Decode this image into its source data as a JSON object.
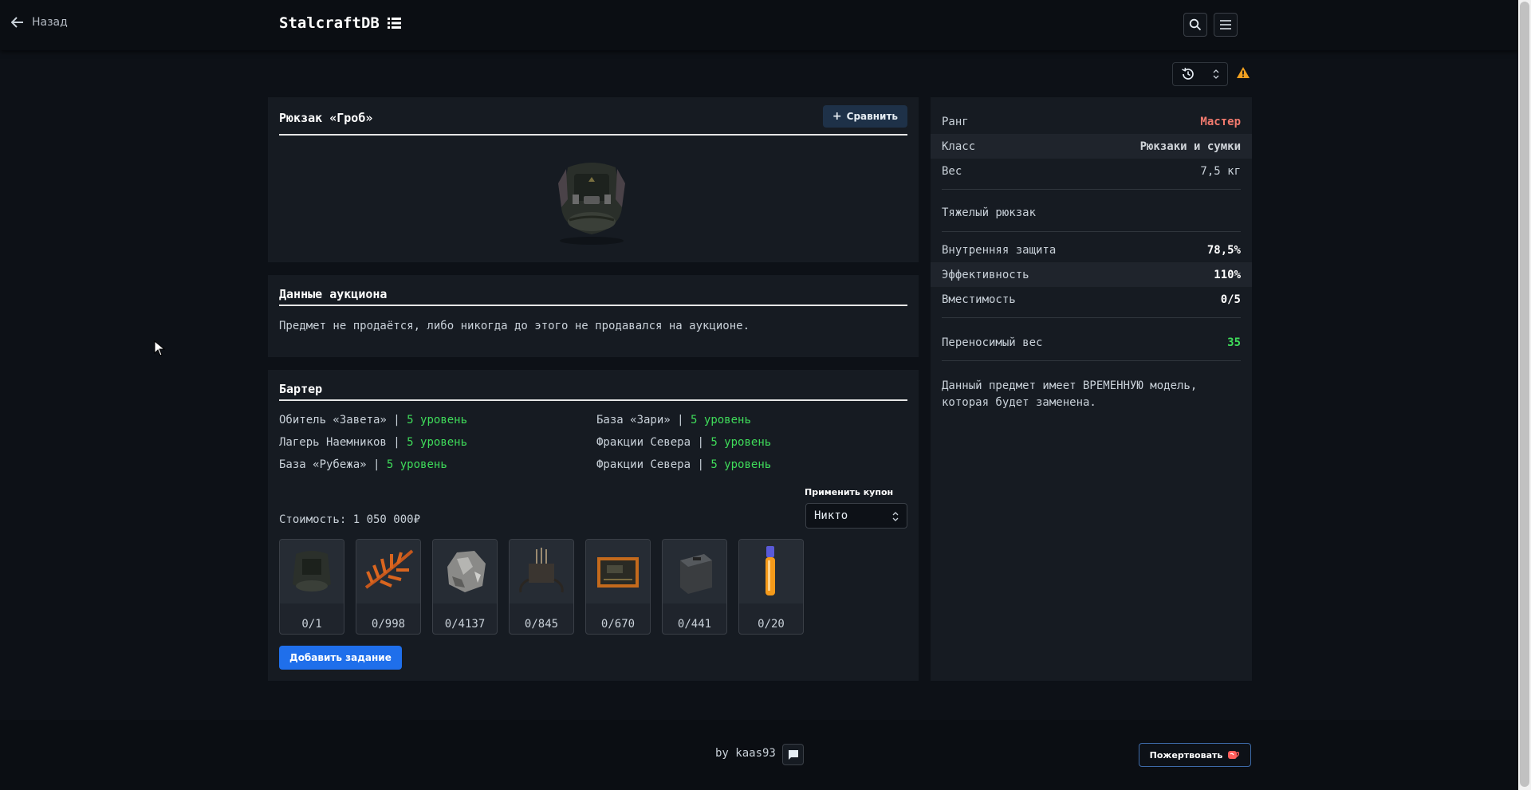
{
  "header": {
    "back_label": "Назад",
    "brand": "StalcraftDB"
  },
  "item": {
    "name": "Рюкзак «Гроб»",
    "compare_label": "Сравнить"
  },
  "auction": {
    "title": "Данные аукциона",
    "message": "Предмет не продаётся, либо никогда до этого не продавался на аукционе."
  },
  "barter": {
    "title": "Бартер",
    "separator": "|",
    "entries": [
      {
        "place": "Обитель «Завета»",
        "level": "5 уровень"
      },
      {
        "place": "База «Зари»",
        "level": "5 уровень"
      },
      {
        "place": "Лагерь Наемников",
        "level": "5 уровень"
      },
      {
        "place": "Фракции Севера",
        "level": "5 уровень"
      },
      {
        "place": "База «Рубежа»",
        "level": "5 уровень"
      },
      {
        "place": "Фракции Севера",
        "level": "5 уровень"
      }
    ],
    "coupon_label": "Применить купон",
    "coupon_value": "Никто",
    "cost": "Стоимость: 1 050 000₽",
    "ingredients": [
      {
        "count": "0/1",
        "icon": "backpack"
      },
      {
        "count": "0/998",
        "icon": "orange-fern"
      },
      {
        "count": "0/4137",
        "icon": "ore-chunk"
      },
      {
        "count": "0/845",
        "icon": "device-part"
      },
      {
        "count": "0/670",
        "icon": "circuit-board"
      },
      {
        "count": "0/441",
        "icon": "battery-case"
      },
      {
        "count": "0/20",
        "icon": "vial"
      }
    ],
    "add_task_label": "Добавить задание"
  },
  "stats": {
    "rank_label": "Ранг",
    "rank_value": "Мастер",
    "class_label": "Класс",
    "class_value": "Рюкзаки и сумки",
    "weight_label": "Вес",
    "weight_value": "7,5 кг",
    "type": "Тяжелый рюкзак",
    "protection_label": "Внутренняя защита",
    "protection_value": "78,5%",
    "efficiency_label": "Эффективность",
    "efficiency_value": "110%",
    "capacity_label": "Вместимость",
    "capacity_value": "0/5",
    "carry_label": "Переносимый вес",
    "carry_value": "35",
    "note": "Данный предмет имеет ВРЕМЕННУЮ модель, которая будет заменена."
  },
  "footer": {
    "by": "by kaas93",
    "donate_label": "Пожертвовать"
  },
  "colors": {
    "rank": "#f27a6e",
    "level": "#3fdc5a",
    "accent": "#1f6feb"
  }
}
